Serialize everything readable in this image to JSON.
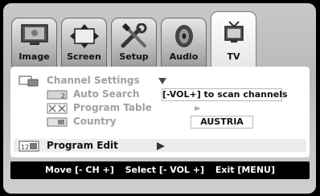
{
  "tabs": [
    {
      "label": "Image",
      "icon": "monitor-icon",
      "active": false
    },
    {
      "label": "Screen",
      "icon": "arrows-icon",
      "active": false
    },
    {
      "label": "Setup",
      "icon": "tools-icon",
      "active": false
    },
    {
      "label": "Audio",
      "icon": "speaker-icon",
      "active": false
    },
    {
      "label": "TV",
      "icon": "tv-icon",
      "active": true
    }
  ],
  "menu": {
    "channel_settings": "Channel Settings",
    "auto_search": "Auto Search",
    "auto_search_value": "[-VOL+] to scan channels",
    "program_table": "Program Table",
    "country": "Country",
    "country_value": "AUSTRIA",
    "program_edit": "Program Edit"
  },
  "footer": {
    "move": "Move [- CH +]",
    "select": "Select [- VOL +]",
    "exit": "Exit [MENU]"
  },
  "colors": {
    "text_active": "#111111",
    "text_dim": "#a0a0a0",
    "footer_bg": "#000000",
    "accent": "#3a3a3a"
  }
}
